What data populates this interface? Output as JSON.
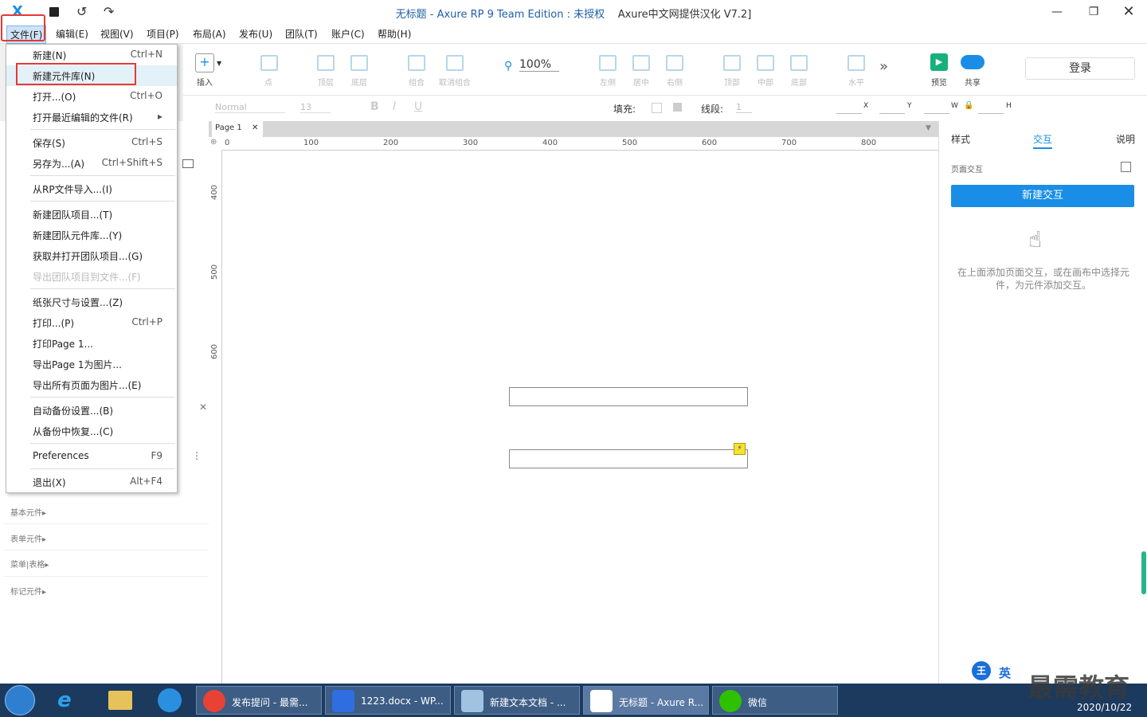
{
  "window": {
    "title_left": "无标题 - Axure RP 9 Team Edition : ",
    "title_unlicensed": "未授权",
    "title_right": "Axure中文网提供汉化 V7.2]",
    "logo": "X"
  },
  "menubar": [
    "文件(F)",
    "编辑(E)",
    "视图(V)",
    "项目(P)",
    "布局(A)",
    "发布(U)",
    "团队(T)",
    "账户(C)",
    "帮助(H)"
  ],
  "file_menu": [
    {
      "label": "新建(N)",
      "shortcut": "Ctrl+N"
    },
    {
      "label": "新建元件库(N)",
      "shortcut": ""
    },
    {
      "label": "打开...(O)",
      "shortcut": "Ctrl+O"
    },
    {
      "label": "打开最近编辑的文件(R)",
      "shortcut": "▸"
    },
    {
      "label": "保存(S)",
      "shortcut": "Ctrl+S"
    },
    {
      "label": "另存为...(A)",
      "shortcut": "Ctrl+Shift+S"
    },
    {
      "label": "从RP文件导入...(I)",
      "shortcut": ""
    },
    {
      "label": "新建团队项目...(T)",
      "shortcut": ""
    },
    {
      "label": "新建团队元件库...(Y)",
      "shortcut": ""
    },
    {
      "label": "获取并打开团队项目...(G)",
      "shortcut": ""
    },
    {
      "label": "导出团队项目到文件...(F)",
      "shortcut": ""
    },
    {
      "label": "纸张尺寸与设置...(Z)",
      "shortcut": ""
    },
    {
      "label": "打印...(P)",
      "shortcut": "Ctrl+P"
    },
    {
      "label": "打印Page 1...",
      "shortcut": ""
    },
    {
      "label": "导出Page 1为图片...",
      "shortcut": ""
    },
    {
      "label": "导出所有页面为图片...(E)",
      "shortcut": ""
    },
    {
      "label": "自动备份设置...(B)",
      "shortcut": ""
    },
    {
      "label": "从备份中恢复...(C)",
      "shortcut": ""
    },
    {
      "label": "Preferences",
      "shortcut": "F9"
    },
    {
      "label": "退出(X)",
      "shortcut": "Alt+F4"
    }
  ],
  "toolbar": {
    "insert": "插入",
    "point": "点",
    "top_layer": "顶层",
    "bottom_layer": "底层",
    "group": "组合",
    "ungroup": "取消组合",
    "left": "左侧",
    "center": "居中",
    "right": "右侧",
    "top": "顶部",
    "middle": "中部",
    "bottom": "底部",
    "horizontal": "水平",
    "zoom": "100%",
    "preview": "预览",
    "share": "共享",
    "login": "登录"
  },
  "formatbar": {
    "font_style": "Normal",
    "font_size": "13",
    "fill": "填充:",
    "stroke": "线段:",
    "stroke_value": "1",
    "x": "X",
    "y": "Y",
    "w": "W",
    "h": "H"
  },
  "canvas": {
    "tab": "Page 1",
    "ruler_h": [
      "0",
      "100",
      "200",
      "300",
      "400",
      "500",
      "600",
      "700",
      "800"
    ],
    "ruler_v": [
      "400",
      "500",
      "600"
    ]
  },
  "left_panel": {
    "libraries": [
      "基本元件▸",
      "表单元件▸",
      "菜单|表格▸",
      "标记元件▸"
    ]
  },
  "right_panel": {
    "tabs": [
      "样式",
      "交互",
      "说明"
    ],
    "section": "页面交互",
    "new_interaction": "新建交互",
    "hint": "在上面添加页面交互，或在画布中选择元件，为元件添加交互。"
  },
  "taskbar": {
    "tasks": [
      "发布提问 - 最需...",
      "1223.docx - WP...",
      "新建文本文档 - ...",
      "无标题 - Axure R...",
      "微信"
    ],
    "ime": "英",
    "date": "2020/10/22",
    "watermark": "最需教育"
  },
  "colors": {
    "accent": "#1a8ee6",
    "highlight": "#e53935",
    "title": "#1f5fa8",
    "taskbar": "#1c3a5e"
  }
}
